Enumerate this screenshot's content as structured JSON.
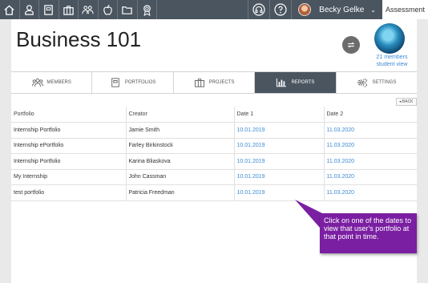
{
  "topnav": {
    "icons": [
      "home-icon",
      "user-icon",
      "portfolio-book-icon",
      "briefcase-icon",
      "group-icon",
      "apple-icon",
      "folder-icon",
      "award-icon"
    ],
    "right_icons": [
      "headset-icon",
      "help-icon"
    ],
    "user_name": "Becky Gelke",
    "caret": "⌄",
    "assessment_label": "Assessment"
  },
  "course": {
    "title": "Business 101",
    "members_count": "21 members",
    "student_view": "student view"
  },
  "tabs": [
    {
      "label": "MEMBERS",
      "icon": "members-icon"
    },
    {
      "label": "PORTFOLIOS",
      "icon": "portfolios-icon"
    },
    {
      "label": "PROJECTS",
      "icon": "projects-icon"
    },
    {
      "label": "REPORTS",
      "icon": "reports-icon"
    },
    {
      "label": "SETTINGS",
      "icon": "settings-icon"
    }
  ],
  "back_label": "◂ BACK",
  "table": {
    "headers": [
      "Portfolio",
      "Creator",
      "Date 1",
      "Date 2"
    ],
    "rows": [
      [
        "Internship Portfolio",
        "Jamie Smith",
        "10.01.2019",
        "11.03.2020"
      ],
      [
        "Internship ePortfolio",
        "Farley Birkinstock",
        "10.01.2019",
        "11.03.2020"
      ],
      [
        "Internship Portfolio",
        "Karina Bliaskova",
        "10.01.2019",
        "11.03.2020"
      ],
      [
        "My Internship",
        "John Cassman",
        "10.01.2019",
        "11.03.2020"
      ],
      [
        "test portfolio",
        "Patricia Freedman",
        "10.01.2019",
        "11.03.2020"
      ]
    ]
  },
  "callout": {
    "text": "Click on one of the dates to view that user's portfolio at that point in time.",
    "color": "#7b1fa2"
  }
}
